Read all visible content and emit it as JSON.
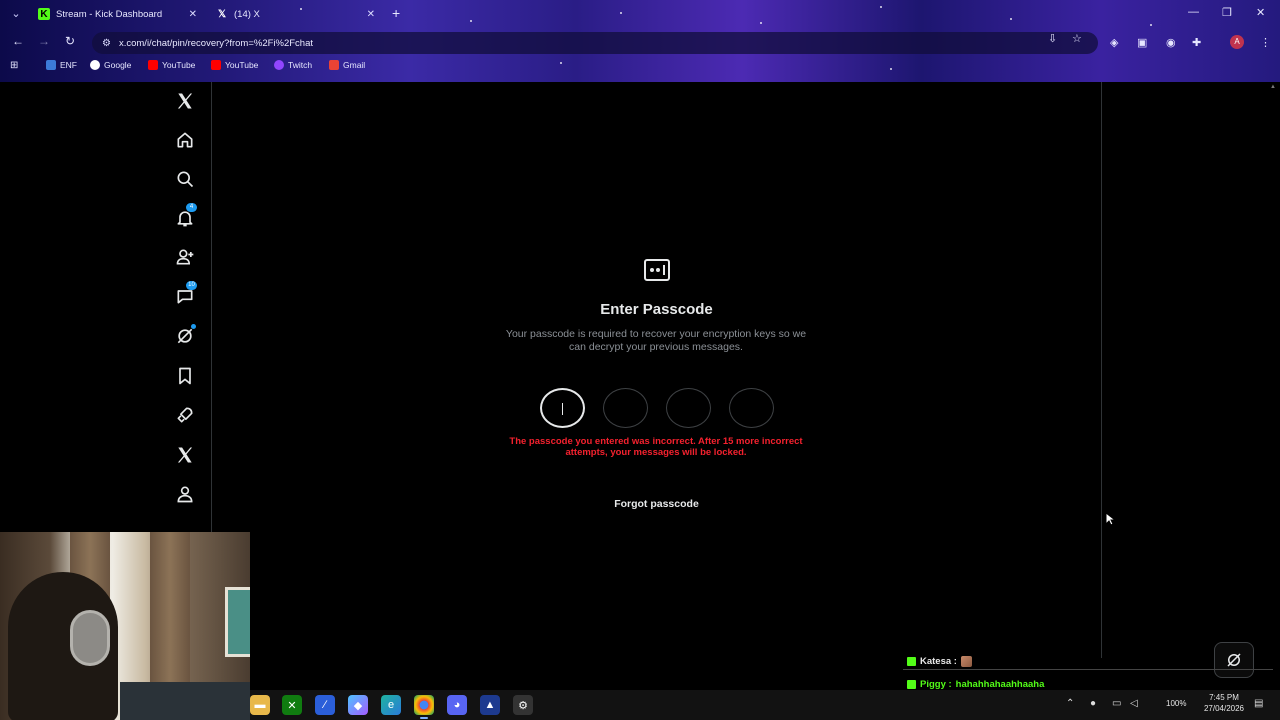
{
  "browser": {
    "tabs": [
      {
        "title": "Stream - Kick Dashboard",
        "favicon": "kick-icon"
      },
      {
        "title": "(14) X",
        "favicon": "x-logo-icon"
      }
    ],
    "url": "x.com/i/chat/pin/recovery?from=%2Fi%2Fchat",
    "bookmarks": [
      {
        "label": "ENF"
      },
      {
        "label": "Google"
      },
      {
        "label": "YouTube"
      },
      {
        "label": "YouTube"
      },
      {
        "label": "Twitch"
      },
      {
        "label": "Gmail"
      }
    ],
    "profile_initial": "A"
  },
  "sidebar": {
    "items": [
      {
        "name": "x-logo-icon"
      },
      {
        "name": "home-icon"
      },
      {
        "name": "search-icon"
      },
      {
        "name": "notifications-icon",
        "badge": "4"
      },
      {
        "name": "follow-icon"
      },
      {
        "name": "chat-icon",
        "badge": "10"
      },
      {
        "name": "grok-icon"
      },
      {
        "name": "bookmarks-icon"
      },
      {
        "name": "rocket-icon"
      },
      {
        "name": "premium-x-icon"
      },
      {
        "name": "profile-icon"
      }
    ]
  },
  "main": {
    "heading": "Enter Passcode",
    "description": "Your passcode is required to recover your encryption keys so we can decrypt your previous messages.",
    "error": "The passcode you entered was incorrect. After 15 more incorrect attempts, your messages will be locked.",
    "forgot_label": "Forgot passcode",
    "pin_slots": 4
  },
  "stream_chat": [
    {
      "user": "Katesa :",
      "message": ""
    },
    {
      "user": "Piggy :",
      "message": "hahahhahaahhaaha"
    }
  ],
  "taskbar": {
    "time": "7:45 PM",
    "date": "27/04/2026",
    "battery": "100%"
  },
  "colors": {
    "error": "#f4212e",
    "accent": "#1d9bf0",
    "kick_green": "#53fc18"
  }
}
